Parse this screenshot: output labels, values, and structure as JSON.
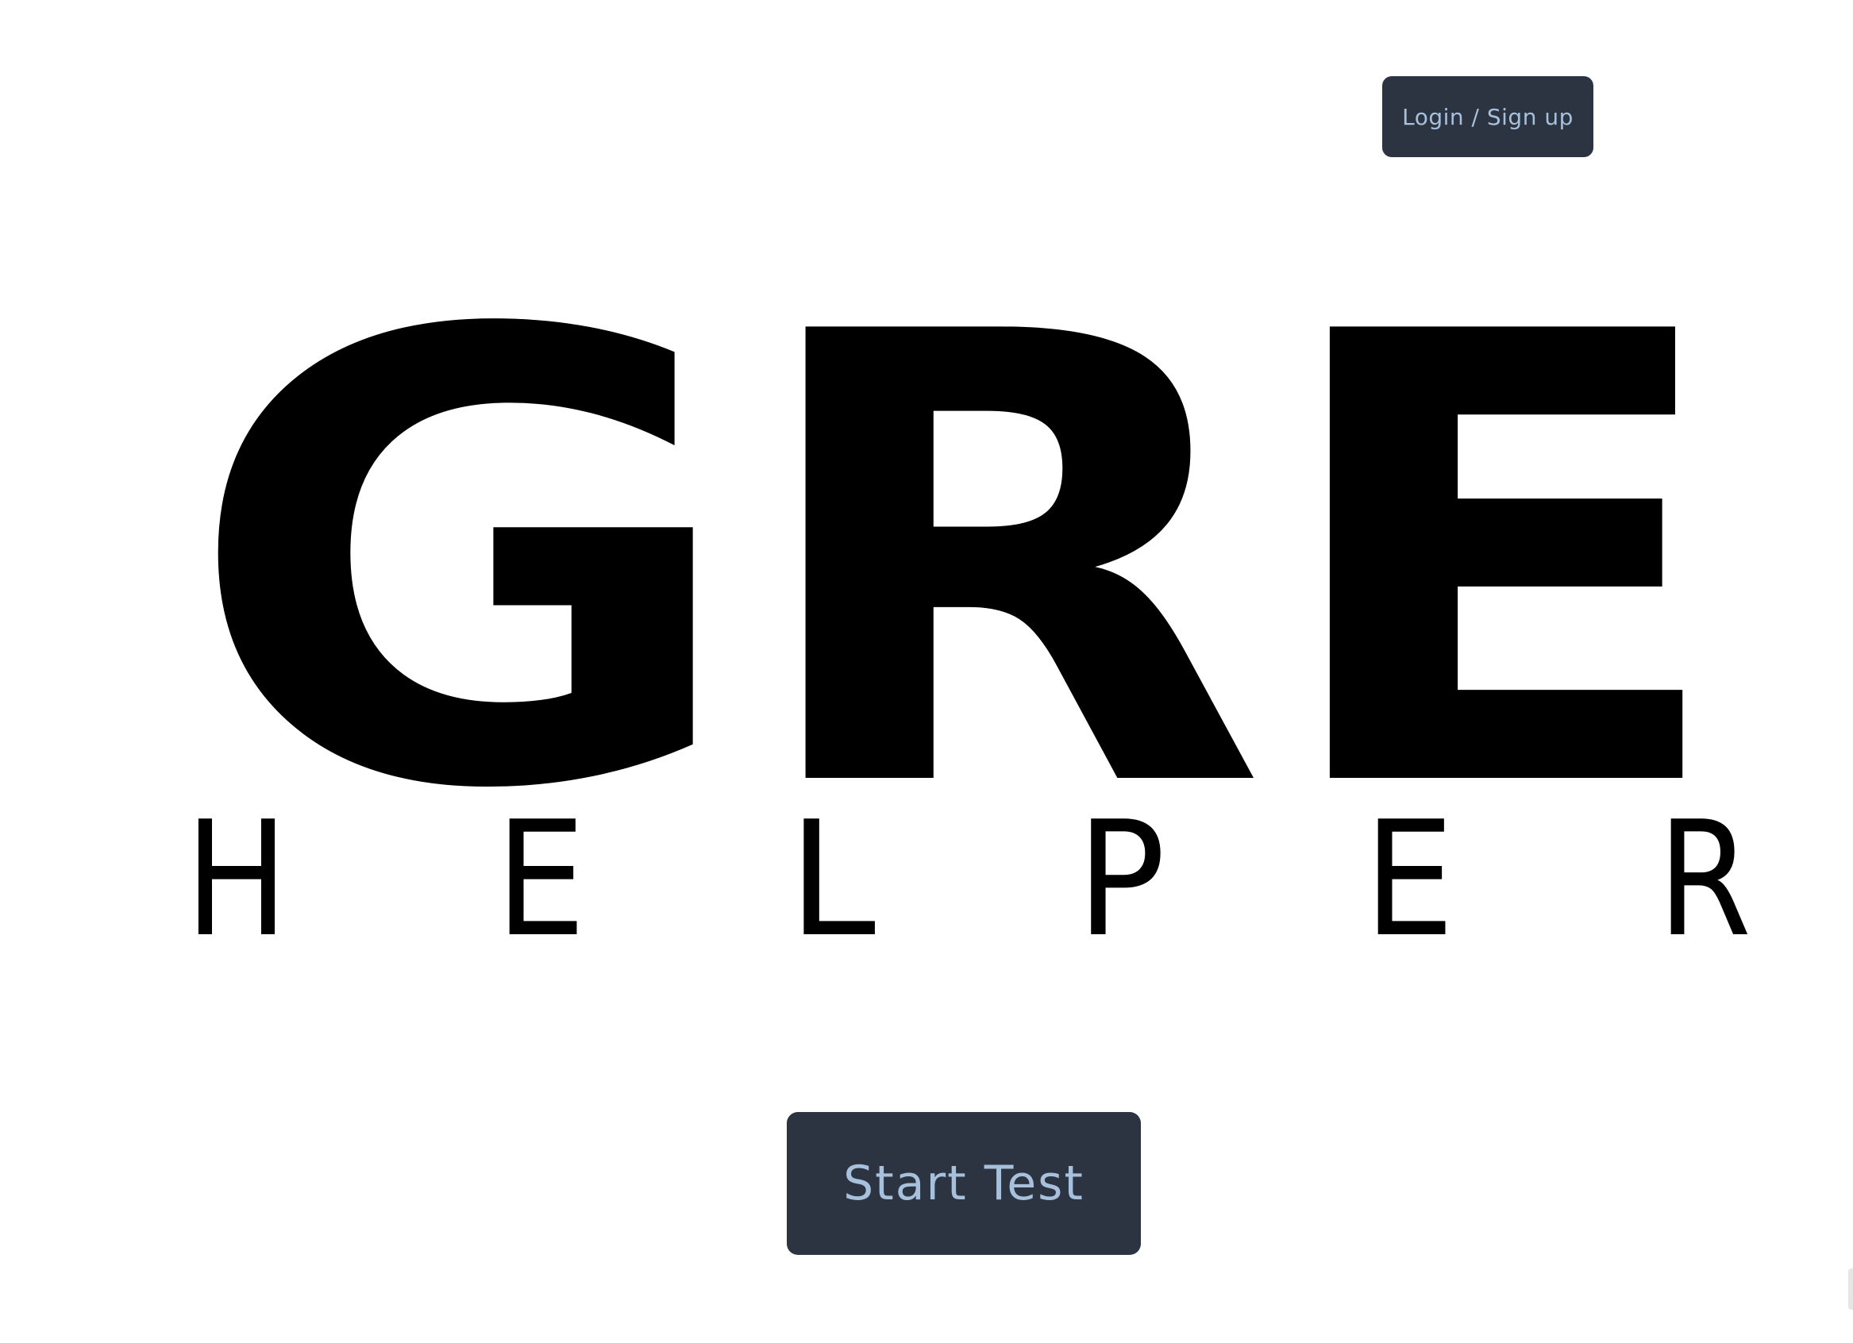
{
  "header": {
    "login_label": "Login / Sign up"
  },
  "logo": {
    "main": "GRE",
    "sub": "HELPER",
    "sub_letters": [
      "H",
      "E",
      "L",
      "P",
      "E",
      "R"
    ]
  },
  "actions": {
    "start_label": "Start Test"
  },
  "colors": {
    "button_bg": "#2c3341",
    "button_text": "#a7c0dc",
    "logo": "#000000",
    "background": "#ffffff"
  }
}
